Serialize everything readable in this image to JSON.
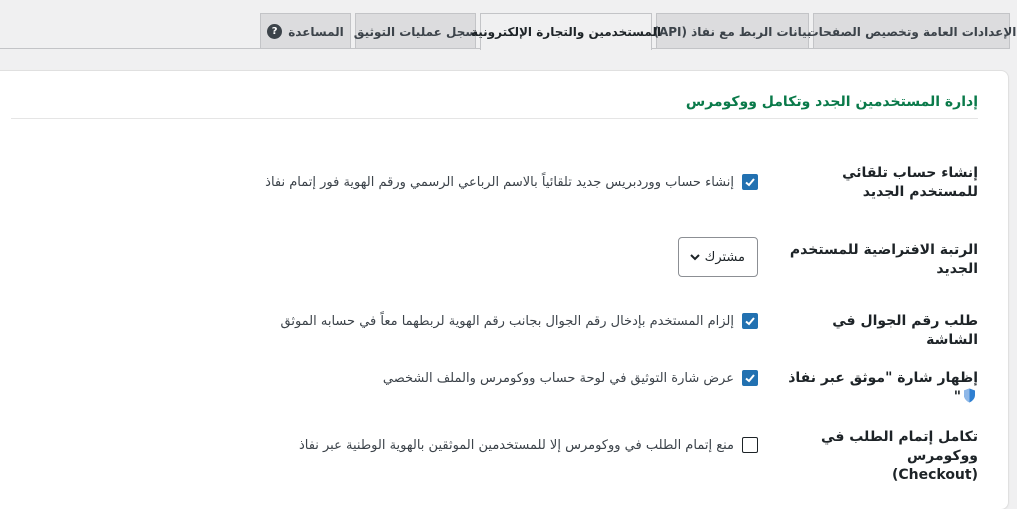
{
  "tabs": [
    {
      "label": "الإعدادات العامة وتخصيص الصفحات"
    },
    {
      "label": "بيانات الربط مع نفاذ (API)"
    },
    {
      "label": "المستخدمين والتجارة الإلكترونية",
      "active": true
    },
    {
      "label": "سجل عمليات التوثيق"
    },
    {
      "label": "المساعدة",
      "icon": "help-icon"
    }
  ],
  "section": {
    "title": "إدارة المستخدمين الجدد وتكامل ووكومرس"
  },
  "rows": {
    "auto_create": {
      "label": "إنشاء حساب تلقائي للمستخدم الجديد",
      "checkbox_label": "إنشاء حساب ووردبريس جديد تلقائياً بالاسم الرباعي الرسمي ورقم الهوية فور إتمام نفاذ",
      "checked": true
    },
    "default_role": {
      "label": "الرتبة الافتراضية للمستخدم الجديد",
      "selected": "مشترك"
    },
    "require_phone": {
      "label": "طلب رقم الجوال في الشاشة",
      "checkbox_label": "إلزام المستخدم بإدخال رقم الجوال بجانب رقم الهوية لربطهما معاً في حسابه الموثق",
      "checked": true
    },
    "badge": {
      "label_before": "إظهار شارة \"موثق عبر نفاذ",
      "label_after": "\"",
      "checkbox_label": "عرض شارة التوثيق في لوحة حساب ووكومرس والملف الشخصي",
      "checked": true
    },
    "checkout": {
      "label_line1": "تكامل إتمام الطلب في ووكومرس",
      "label_line2": "(Checkout)",
      "checkbox_label": "منع إتمام الطلب في ووكومرس إلا للمستخدمين الموثقين بالهوية الوطنية عبر نفاذ",
      "checked": false
    }
  },
  "colors": {
    "accent": "#2271b1",
    "title": "#0a7a4a",
    "shield": "#2f7fd1"
  }
}
